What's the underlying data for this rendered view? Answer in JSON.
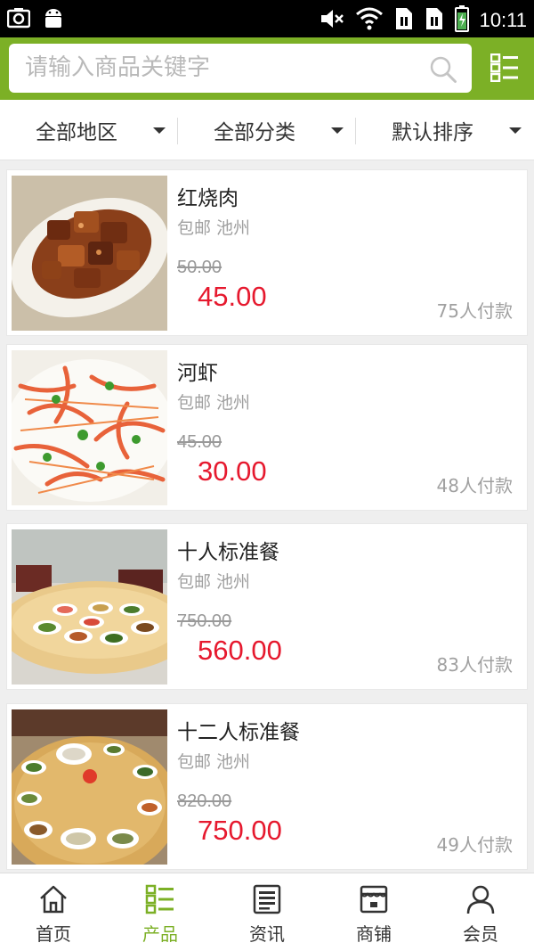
{
  "status_bar": {
    "time": "10:11",
    "left_icons": [
      "screenshot-icon",
      "android-icon"
    ],
    "right_icons": [
      "mute-icon",
      "wifi-icon",
      "sim1-icon",
      "sim2-icon",
      "battery-charging-icon"
    ]
  },
  "header": {
    "search_placeholder": "请输入商品关键字",
    "accent_color": "#7cb026"
  },
  "filters": [
    {
      "label": "全部地区"
    },
    {
      "label": "全部分类"
    },
    {
      "label": "默认排序"
    }
  ],
  "products": [
    {
      "title": "红烧肉",
      "meta": "包邮 池州",
      "old_price": "50.00",
      "price": "45.00",
      "paid": "75人付款",
      "image": "braised-pork-photo"
    },
    {
      "title": "河虾",
      "meta": "包邮 池州",
      "old_price": "45.00",
      "price": "30.00",
      "paid": "48人付款",
      "image": "river-shrimp-photo"
    },
    {
      "title": "十人标准餐",
      "meta": "包邮 池州",
      "old_price": "750.00",
      "price": "560.00",
      "paid": "83人付款",
      "image": "ten-person-meal-photo"
    },
    {
      "title": "十二人标准餐",
      "meta": "包邮 池州",
      "old_price": "820.00",
      "price": "750.00",
      "paid": "49人付款",
      "image": "twelve-person-meal-photo"
    }
  ],
  "bottom_nav": [
    {
      "label": "首页",
      "icon": "home-icon",
      "active": false
    },
    {
      "label": "产品",
      "icon": "product-list-icon",
      "active": true
    },
    {
      "label": "资讯",
      "icon": "news-icon",
      "active": false
    },
    {
      "label": "商铺",
      "icon": "shop-icon",
      "active": false
    },
    {
      "label": "会员",
      "icon": "member-icon",
      "active": false
    }
  ]
}
